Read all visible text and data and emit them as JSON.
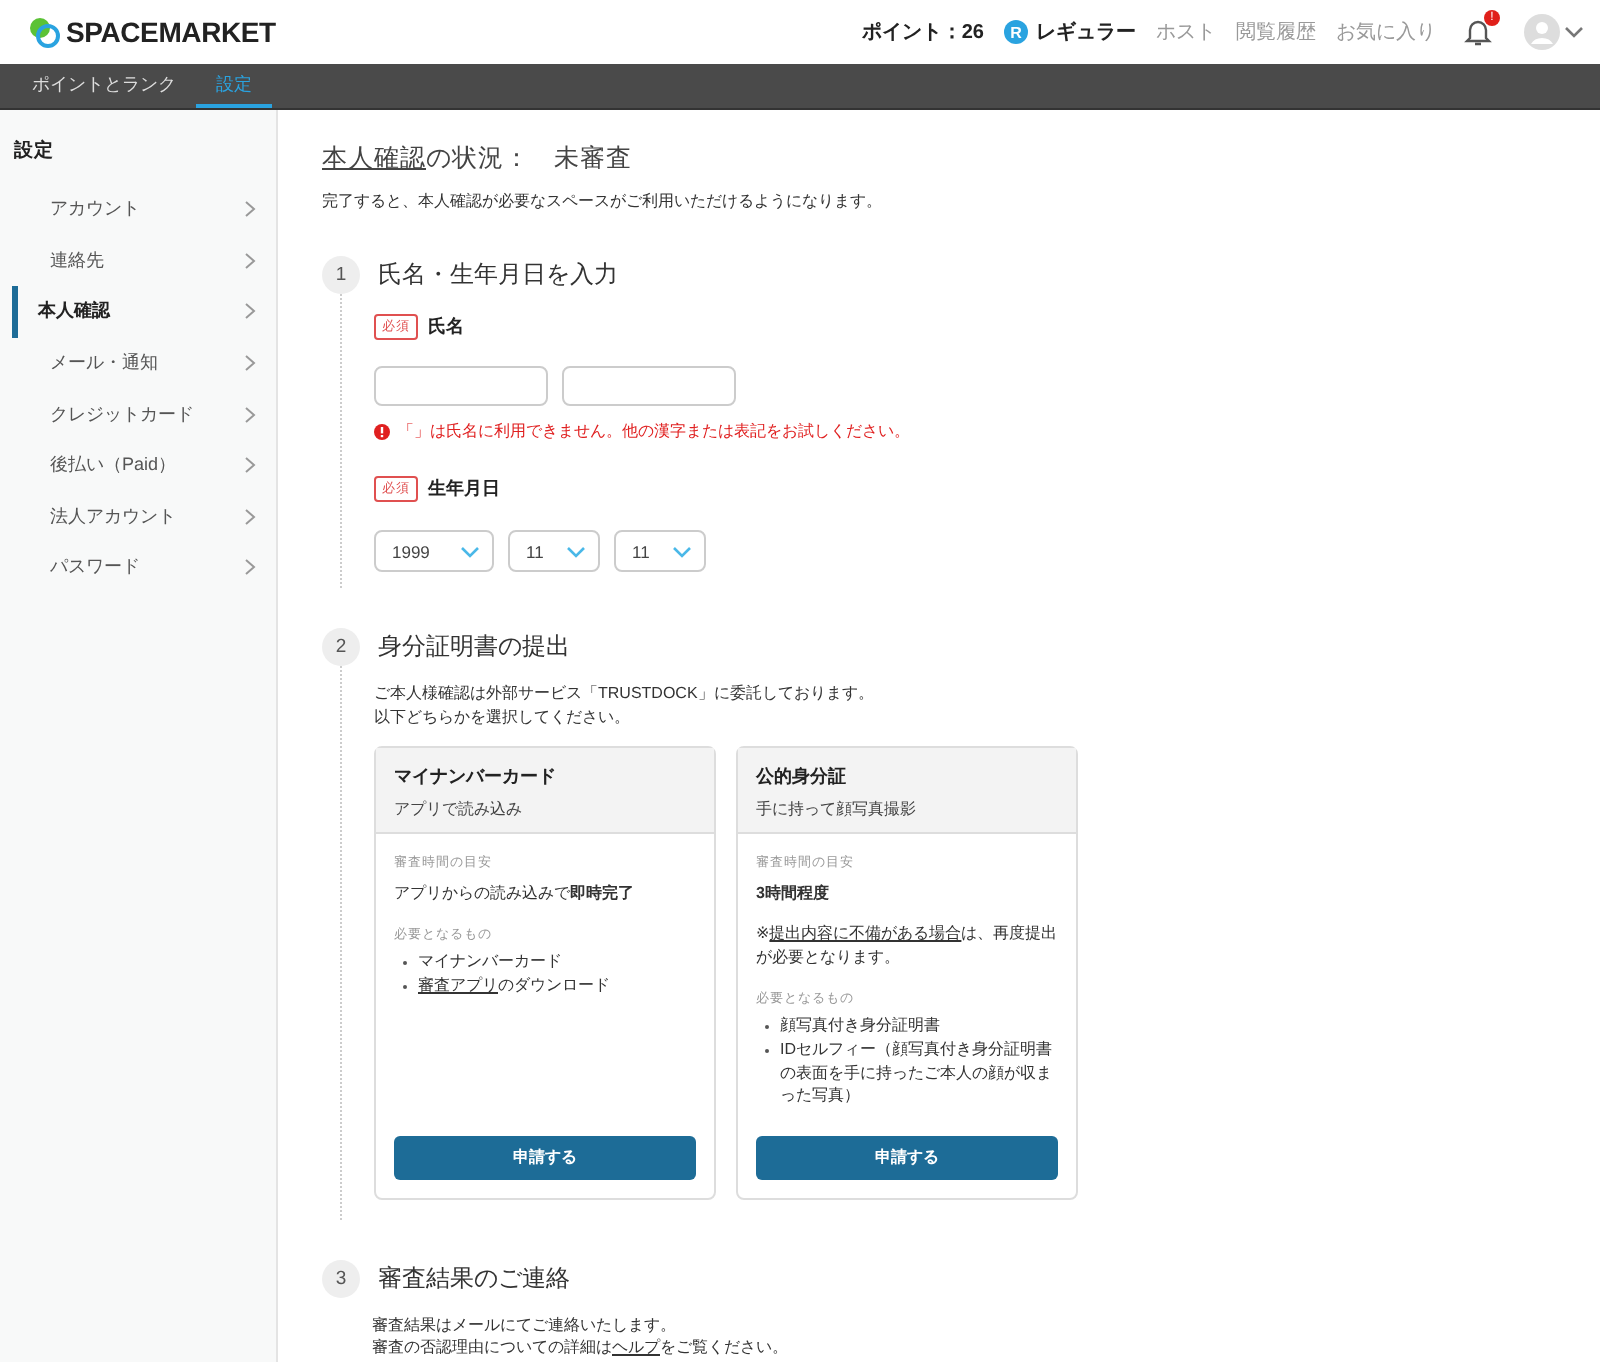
{
  "header": {
    "logo": "SPACEMARKET",
    "points": "ポイント：26",
    "rank_badge": "R",
    "rank": "レギュラー",
    "links": [
      "ホスト",
      "閲覧履歴",
      "お気に入り"
    ],
    "notification_badge": "!"
  },
  "tabs": [
    {
      "label": "ポイントとランク",
      "selected": false
    },
    {
      "label": "設定",
      "selected": true
    }
  ],
  "sidebar": {
    "title": "設定",
    "items": [
      {
        "label": "アカウント",
        "selected": false
      },
      {
        "label": "連絡先",
        "selected": false
      },
      {
        "label": "本人確認",
        "selected": true
      },
      {
        "label": "メール・通知",
        "selected": false
      },
      {
        "label": "クレジットカード",
        "selected": false
      },
      {
        "label": "後払い（Paid）",
        "selected": false
      },
      {
        "label": "法人アカウント",
        "selected": false
      },
      {
        "label": "パスワード",
        "selected": false
      }
    ]
  },
  "status": {
    "title": [
      {
        "text": "本人確認",
        "link": true
      },
      {
        "text": "の状況：",
        "link": false
      }
    ],
    "value": "未審査",
    "description": "完了すると、本人確認が必要なスペースがご利用いただけるようになります。"
  },
  "step1": {
    "number": "1",
    "title": "氏名・生年月日を入力",
    "name": {
      "required_badge": "必須",
      "label": "氏名"
    },
    "error": "「」は氏名に利用できません。他の漢字または表記をお試しください。",
    "birth": {
      "required_badge": "必須",
      "label": "生年月日",
      "selects": [
        "1999",
        "11",
        "11"
      ]
    }
  },
  "step2": {
    "number": "2",
    "title": "身分証明書の提出",
    "intro": [
      "ご本人様確認は外部サービス「TRUSTDOCK」に委託しております。",
      "以下どちらかを選択してください。"
    ],
    "cards": [
      {
        "title": "マイナンバーカード",
        "subtitle": "アプリで読み込み",
        "time_label": "審査時間の目安",
        "time_value": "アプリからの読み込みで**即時完了**",
        "time_bold": false,
        "needs_label": "必要となるもの",
        "needs": [
          [
            {
              "text": "マイナンバーカード",
              "link": false
            }
          ],
          [
            {
              "text": "審査アプリ",
              "link": true
            },
            {
              "text": "のダウンロード",
              "link": false
            }
          ]
        ],
        "button": "申請する"
      },
      {
        "title": "公的身分証",
        "subtitle": "手に持って顔写真撮影",
        "time_label": "審査時間の目安",
        "time_value": "3時間程度",
        "time_bold": true,
        "note": [
          {
            "text": "※",
            "link": false
          },
          {
            "text": "提出内容に不備がある場合",
            "link": true
          },
          {
            "text": "は、再度提出が必要となります。",
            "link": false
          }
        ],
        "needs_label": "必要となるもの",
        "needs": [
          [
            {
              "text": "顔写真付き身分証明書",
              "link": false
            }
          ],
          [
            {
              "text": "IDセルフィー（顔写真付き身分証明書の表面を手に持ったご本人の顔が収まった写真）",
              "link": false
            }
          ]
        ],
        "button": "申請する"
      }
    ]
  },
  "step3": {
    "number": "3",
    "title": "審査結果のご連絡",
    "lines": [
      [
        {
          "text": "審査結果はメールにてご連絡いたします。",
          "link": false
        }
      ],
      [
        {
          "text": "審査の否認理由についての詳細は",
          "link": false
        },
        {
          "text": "ヘルプ",
          "link": true
        },
        {
          "text": "をご覧ください。",
          "link": false
        }
      ]
    ]
  }
}
